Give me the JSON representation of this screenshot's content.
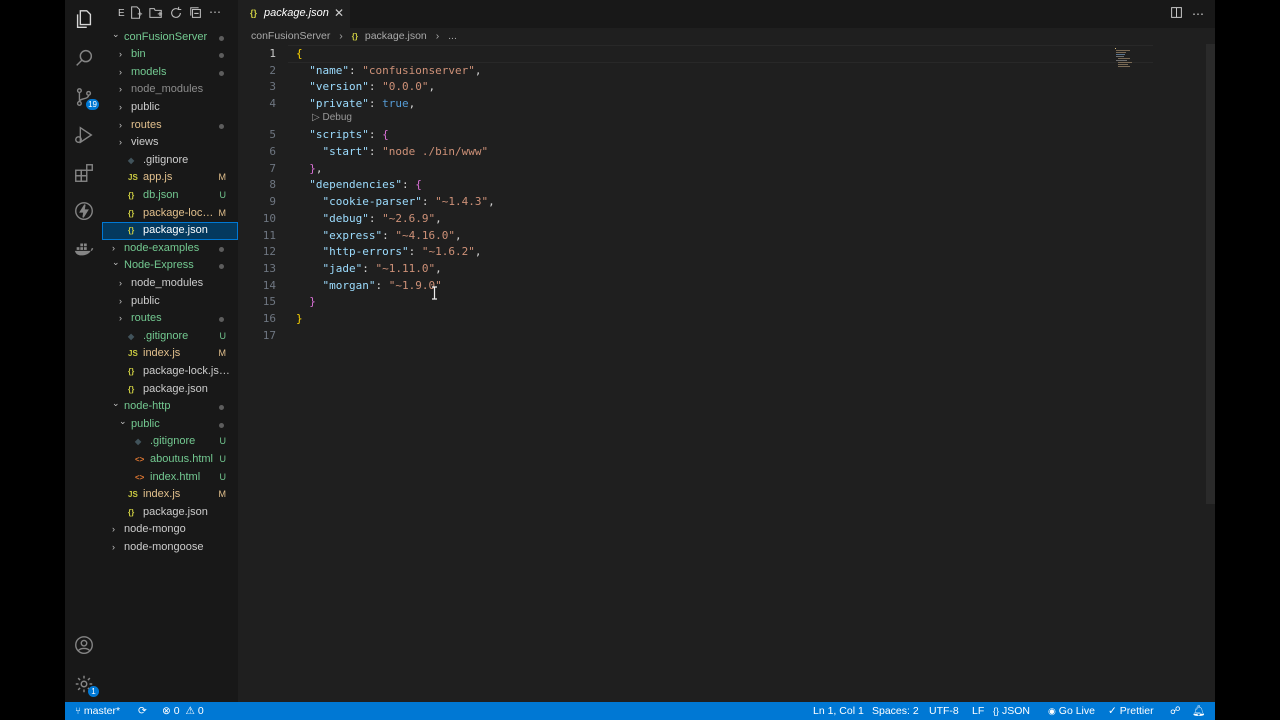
{
  "activity_bar": {
    "items": [
      {
        "name": "explorer-icon"
      },
      {
        "name": "search-icon"
      },
      {
        "name": "source-control-icon",
        "badge": "19"
      },
      {
        "name": "run-debug-icon"
      },
      {
        "name": "extensions-icon"
      },
      {
        "name": "thunder-client-icon"
      },
      {
        "name": "docker-icon"
      }
    ],
    "bottom": [
      {
        "name": "accounts-icon"
      },
      {
        "name": "manage-gear-icon",
        "badge": "1"
      }
    ]
  },
  "sidebar": {
    "toolbar_letter": "E",
    "tree": [
      {
        "label": "conFusionServer",
        "depth": 0,
        "kind": "folder-open",
        "color": "#73c991",
        "dot": true
      },
      {
        "label": "bin",
        "depth": 1,
        "kind": "folder",
        "color": "#73c991",
        "dot": true
      },
      {
        "label": "models",
        "depth": 1,
        "kind": "folder",
        "color": "#73c991",
        "dot": true
      },
      {
        "label": "node_modules",
        "depth": 1,
        "kind": "folder",
        "color": "#8c8c8c"
      },
      {
        "label": "public",
        "depth": 1,
        "kind": "folder",
        "color": "#cccccc"
      },
      {
        "label": "routes",
        "depth": 1,
        "kind": "folder",
        "color": "#e2c08d",
        "dot": true
      },
      {
        "label": "views",
        "depth": 1,
        "kind": "folder",
        "color": "#cccccc"
      },
      {
        "label": ".gitignore",
        "depth": 1,
        "kind": "git",
        "color": "#cccccc"
      },
      {
        "label": "app.js",
        "depth": 1,
        "kind": "js",
        "color": "#e2c08d",
        "status": "M"
      },
      {
        "label": "db.json",
        "depth": 1,
        "kind": "json",
        "color": "#73c991",
        "status": "U"
      },
      {
        "label": "package-lock.json",
        "depth": 1,
        "kind": "json",
        "color": "#e2c08d",
        "status": "M"
      },
      {
        "label": "package.json",
        "depth": 1,
        "kind": "json",
        "color": "#ffffff",
        "selected": true
      },
      {
        "label": "node-examples",
        "depth": 0,
        "kind": "folder",
        "color": "#73c991",
        "dot": true
      },
      {
        "label": "Node-Express",
        "depth": 0,
        "kind": "folder-open",
        "color": "#73c991",
        "dot": true
      },
      {
        "label": "node_modules",
        "depth": 1,
        "kind": "folder",
        "color": "#cccccc"
      },
      {
        "label": "public",
        "depth": 1,
        "kind": "folder",
        "color": "#cccccc"
      },
      {
        "label": "routes",
        "depth": 1,
        "kind": "folder",
        "color": "#73c991",
        "dot": true
      },
      {
        "label": ".gitignore",
        "depth": 1,
        "kind": "git",
        "color": "#73c991",
        "status": "U"
      },
      {
        "label": "index.js",
        "depth": 1,
        "kind": "js",
        "color": "#e2c08d",
        "status": "M"
      },
      {
        "label": "package-lock.json",
        "depth": 1,
        "kind": "json",
        "color": "#cccccc"
      },
      {
        "label": "package.json",
        "depth": 1,
        "kind": "json",
        "color": "#cccccc"
      },
      {
        "label": "node-http",
        "depth": 0,
        "kind": "folder-open",
        "color": "#73c991",
        "dot": true
      },
      {
        "label": "public",
        "depth": 1,
        "kind": "folder-open",
        "color": "#73c991",
        "dot": true
      },
      {
        "label": ".gitignore",
        "depth": 2,
        "kind": "git",
        "color": "#73c991",
        "status": "U"
      },
      {
        "label": "aboutus.html",
        "depth": 2,
        "kind": "html",
        "color": "#73c991",
        "status": "U"
      },
      {
        "label": "index.html",
        "depth": 2,
        "kind": "html",
        "color": "#73c991",
        "status": "U"
      },
      {
        "label": "index.js",
        "depth": 1,
        "kind": "js",
        "color": "#e2c08d",
        "status": "M"
      },
      {
        "label": "package.json",
        "depth": 1,
        "kind": "json",
        "color": "#cccccc"
      },
      {
        "label": "node-mongo",
        "depth": 0,
        "kind": "folder",
        "color": "#cccccc"
      },
      {
        "label": "node-mongoose",
        "depth": 0,
        "kind": "folder",
        "color": "#cccccc"
      }
    ]
  },
  "editor": {
    "tab_label": "package.json",
    "tab_icon": "{}",
    "breadcrumb": [
      "conFusionServer",
      "package.json",
      "..."
    ],
    "codelens": "Debug",
    "lines": [
      {
        "n": "1",
        "cur": true,
        "tokens": [
          [
            "b1",
            "{"
          ]
        ]
      },
      {
        "n": "2",
        "tokens": [
          [
            "p",
            "  "
          ],
          [
            "k",
            "\"name\""
          ],
          [
            "p",
            ": "
          ],
          [
            "s",
            "\"confusionserver\""
          ],
          [
            "p",
            ","
          ]
        ]
      },
      {
        "n": "3",
        "tokens": [
          [
            "p",
            "  "
          ],
          [
            "k",
            "\"version\""
          ],
          [
            "p",
            ": "
          ],
          [
            "s",
            "\"0.0.0\""
          ],
          [
            "p",
            ","
          ]
        ]
      },
      {
        "n": "4",
        "tokens": [
          [
            "p",
            "  "
          ],
          [
            "k",
            "\"private\""
          ],
          [
            "p",
            ": "
          ],
          [
            "kw",
            "true"
          ],
          [
            "p",
            ","
          ]
        ]
      },
      {
        "n": "5",
        "lens": true,
        "tokens": [
          [
            "p",
            "  "
          ],
          [
            "k",
            "\"scripts\""
          ],
          [
            "p",
            ": "
          ],
          [
            "b2",
            "{"
          ]
        ]
      },
      {
        "n": "6",
        "tokens": [
          [
            "p",
            "    "
          ],
          [
            "k",
            "\"start\""
          ],
          [
            "p",
            ": "
          ],
          [
            "s",
            "\"node ./bin/www\""
          ]
        ]
      },
      {
        "n": "7",
        "tokens": [
          [
            "p",
            "  "
          ],
          [
            "b2",
            "}"
          ],
          [
            "p",
            ","
          ]
        ]
      },
      {
        "n": "8",
        "tokens": [
          [
            "p",
            "  "
          ],
          [
            "k",
            "\"dependencies\""
          ],
          [
            "p",
            ": "
          ],
          [
            "b2",
            "{"
          ]
        ]
      },
      {
        "n": "9",
        "tokens": [
          [
            "p",
            "    "
          ],
          [
            "k",
            "\"cookie-parser\""
          ],
          [
            "p",
            ": "
          ],
          [
            "s",
            "\"~1.4.3\""
          ],
          [
            "p",
            ","
          ]
        ]
      },
      {
        "n": "10",
        "tokens": [
          [
            "p",
            "    "
          ],
          [
            "k",
            "\"debug\""
          ],
          [
            "p",
            ": "
          ],
          [
            "s",
            "\"~2.6.9\""
          ],
          [
            "p",
            ","
          ]
        ]
      },
      {
        "n": "11",
        "tokens": [
          [
            "p",
            "    "
          ],
          [
            "k",
            "\"express\""
          ],
          [
            "p",
            ": "
          ],
          [
            "s",
            "\"~4.16.0\""
          ],
          [
            "p",
            ","
          ]
        ]
      },
      {
        "n": "12",
        "tokens": [
          [
            "p",
            "    "
          ],
          [
            "k",
            "\"http-errors\""
          ],
          [
            "p",
            ": "
          ],
          [
            "s",
            "\"~1.6.2\""
          ],
          [
            "p",
            ","
          ]
        ]
      },
      {
        "n": "13",
        "tokens": [
          [
            "p",
            "    "
          ],
          [
            "k",
            "\"jade\""
          ],
          [
            "p",
            ": "
          ],
          [
            "s",
            "\"~1.11.0\""
          ],
          [
            "p",
            ","
          ]
        ]
      },
      {
        "n": "14",
        "tokens": [
          [
            "p",
            "    "
          ],
          [
            "k",
            "\"morgan\""
          ],
          [
            "p",
            ": "
          ],
          [
            "s",
            "\"~1.9.0\""
          ]
        ]
      },
      {
        "n": "15",
        "tokens": [
          [
            "p",
            "  "
          ],
          [
            "b2",
            "}"
          ]
        ]
      },
      {
        "n": "16",
        "tokens": [
          [
            "b1",
            "}"
          ]
        ]
      },
      {
        "n": "17",
        "tokens": []
      }
    ]
  },
  "status_bar": {
    "branch": "master*",
    "problems": "0",
    "warnings": "0",
    "position": "Ln 1, Col 1",
    "spaces": "Spaces: 2",
    "encoding": "UTF-8",
    "eol": "LF",
    "language": "JSON",
    "golive": "Go Live",
    "prettier": "Prettier"
  }
}
